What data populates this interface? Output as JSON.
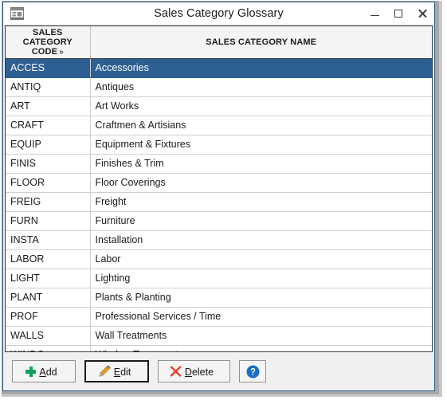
{
  "window": {
    "title": "Sales Category Glossary",
    "icon": "form-window-icon",
    "controls": {
      "minimize": "minimize-button",
      "maximize": "maximize-button",
      "close": "close-button"
    }
  },
  "grid": {
    "columns": [
      {
        "label": "SALES CATEGORY CODE",
        "sort_marker": "»",
        "key": "code"
      },
      {
        "label": "SALES CATEGORY NAME",
        "sort_marker": "",
        "key": "name"
      }
    ],
    "selected_index": 0,
    "rows": [
      {
        "code": "ACCES",
        "name": "Accessories"
      },
      {
        "code": "ANTIQ",
        "name": "Antiques"
      },
      {
        "code": "ART",
        "name": "Art Works"
      },
      {
        "code": "CRAFT",
        "name": "Craftmen & Artisians"
      },
      {
        "code": "EQUIP",
        "name": "Equipment & Fixtures"
      },
      {
        "code": "FINIS",
        "name": "Finishes & Trim"
      },
      {
        "code": "FLOOR",
        "name": "Floor Coverings"
      },
      {
        "code": "FREIG",
        "name": "Freight"
      },
      {
        "code": "FURN",
        "name": "Furniture"
      },
      {
        "code": "INSTA",
        "name": "Installation"
      },
      {
        "code": "LABOR",
        "name": "Labor"
      },
      {
        "code": "LIGHT",
        "name": "Lighting"
      },
      {
        "code": "PLANT",
        "name": "Plants & Planting"
      },
      {
        "code": "PROF",
        "name": "Professional Services / Time"
      },
      {
        "code": "WALLS",
        "name": "Wall Treatments"
      },
      {
        "code": "WINDO",
        "name": "Window Treatments"
      }
    ]
  },
  "buttons": {
    "add": {
      "label": "Add",
      "accel": "A",
      "icon": "plus-icon"
    },
    "edit": {
      "label": "Edit",
      "accel": "E",
      "icon": "pencil-icon",
      "focused": true
    },
    "delete": {
      "label": "Delete",
      "accel": "D",
      "icon": "x-icon"
    },
    "help": {
      "label": "",
      "icon": "question-mark-icon"
    }
  },
  "colors": {
    "selection": "#2e5f92",
    "window_border": "#2a5c91",
    "add_icon": "#12a05c",
    "pencil_icon": "#f0a32a",
    "delete_icon": "#e8412a",
    "help_icon": "#1a6fc4"
  }
}
